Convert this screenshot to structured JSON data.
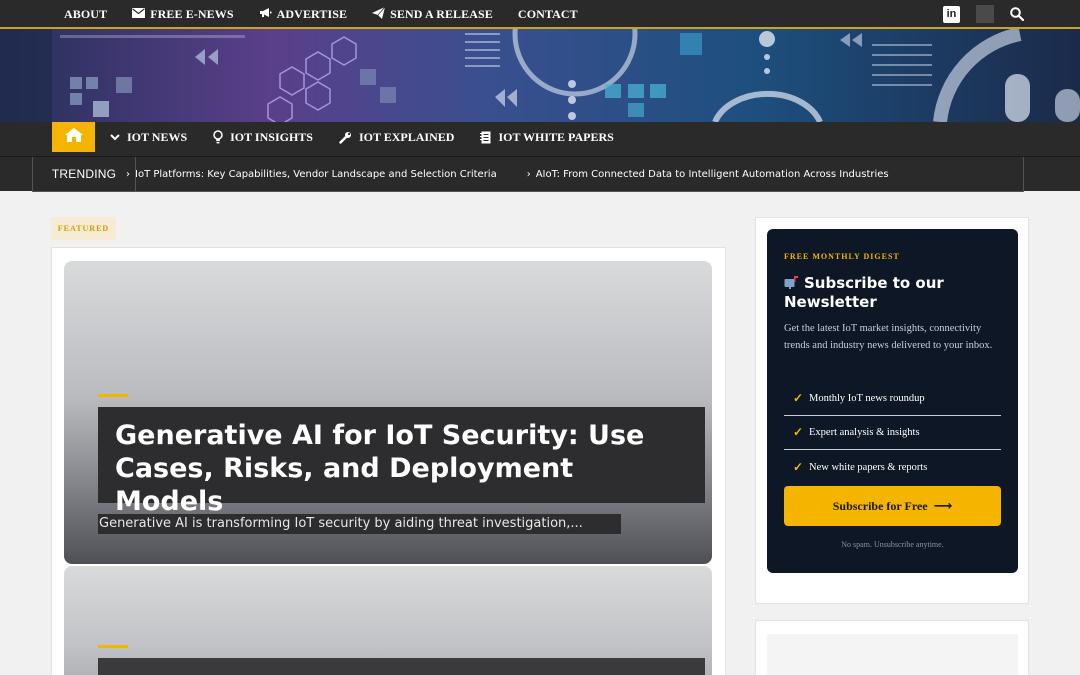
{
  "topnav": {
    "items": [
      {
        "label": "ABOUT",
        "icon": ""
      },
      {
        "label": "FREE E-NEWS",
        "icon": "envelope-icon"
      },
      {
        "label": "ADVERTISE",
        "icon": "megaphone-icon"
      },
      {
        "label": "SEND A RELEASE",
        "icon": "paper-plane-icon"
      },
      {
        "label": "CONTACT",
        "icon": ""
      }
    ],
    "linkedin_label": "in"
  },
  "mainnav": {
    "items": [
      {
        "label": "IOT NEWS",
        "icon": "chevron-down-icon"
      },
      {
        "label": "IOT INSIGHTS",
        "icon": "lightbulb-icon"
      },
      {
        "label": "IOT EXPLAINED",
        "icon": "wrench-icon"
      },
      {
        "label": "IOT WHITE PAPERS",
        "icon": "notebook-icon"
      }
    ]
  },
  "trending": {
    "label": "TRENDING",
    "items": [
      "IoT Platforms: Key Capabilities, Vendor Landscape and Selection Criteria",
      "AIoT: From Connected Data to Intelligent Automation Across Industries"
    ]
  },
  "featured": {
    "tag": "FEATURED",
    "article": {
      "title": "Generative AI for IoT Security: Use Cases, Risks, and Deployment Models",
      "excerpt": "Generative AI is transforming IoT security by aiding threat investigation,..."
    }
  },
  "newsletter": {
    "kicker": "FREE MONTHLY DIGEST",
    "title": "Subscribe to our Newsletter",
    "description": "Get the latest IoT market insights, connectivity trends and industry news delivered to your inbox.",
    "benefits": [
      "Monthly IoT news roundup",
      "Expert analysis & insights",
      "New white papers & reports"
    ],
    "button_label": "Subscribe for Free",
    "button_arrow": "⟶",
    "footnote": "No spam. Unsubscribe anytime."
  },
  "colors": {
    "accent": "#f4b400",
    "nav_bg": "#2a2a2a",
    "newsletter_bg": "#0e1726"
  }
}
